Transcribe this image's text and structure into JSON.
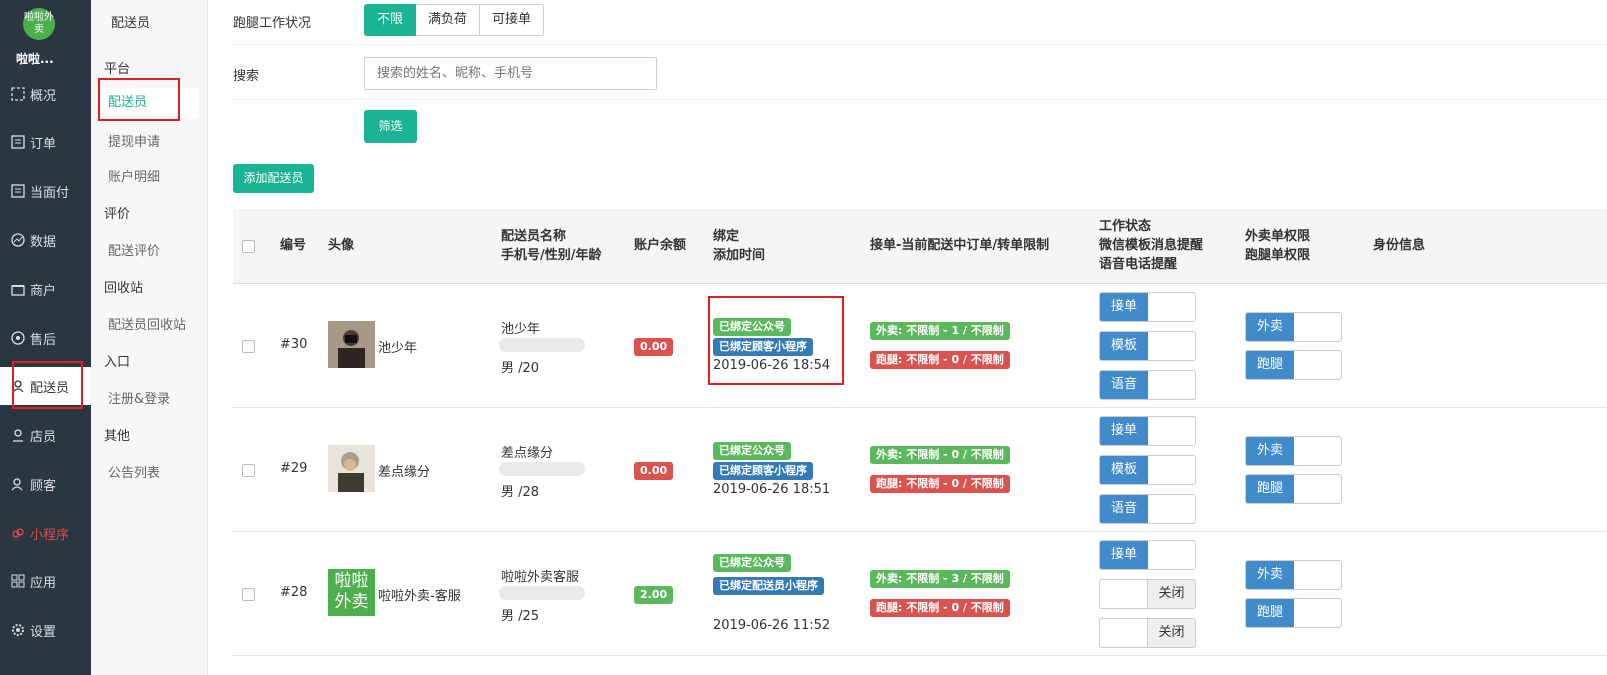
{
  "nav": {
    "logo_text": "啦啦外卖",
    "shop_name": "啦啦...",
    "items": [
      {
        "label": "概况",
        "icon": "dashboard-icon"
      },
      {
        "label": "订单",
        "icon": "order-icon"
      },
      {
        "label": "当面付",
        "icon": "receipt-icon"
      },
      {
        "label": "数据",
        "icon": "chart-icon"
      },
      {
        "label": "商户",
        "icon": "store-icon"
      },
      {
        "label": "售后",
        "icon": "service-icon"
      },
      {
        "label": "配送员",
        "icon": "user-icon"
      },
      {
        "label": "店员",
        "icon": "clerk-icon"
      },
      {
        "label": "顾客",
        "icon": "customer-icon"
      },
      {
        "label": "小程序",
        "icon": "miniprogram-icon"
      },
      {
        "label": "应用",
        "icon": "apps-icon"
      },
      {
        "label": "设置",
        "icon": "gear-icon"
      }
    ]
  },
  "subnav": {
    "title": "配送员",
    "groups": {
      "platform": "平台",
      "review": "评价",
      "recycle": "回收站",
      "entry": "入口",
      "other": "其他"
    },
    "links": {
      "deliverer": "配送员",
      "withdraw": "提现申请",
      "account": "账户明细",
      "delivery_review": "配送评价",
      "deliverer_recycle": "配送员回收站",
      "register": "注册&登录",
      "notice": "公告列表"
    }
  },
  "filters": {
    "status_label": "跑腿工作状况",
    "status_options": [
      "不限",
      "满负荷",
      "可接单"
    ],
    "search_label": "搜索",
    "search_placeholder": "搜索的姓名、昵称、手机号",
    "filter_button": "筛选",
    "add_button": "添加配送员"
  },
  "table": {
    "headers": {
      "id": "编号",
      "avatar": "头像",
      "name_line1": "配送员名称",
      "name_line2": "手机号/性别/年龄",
      "balance": "账户余额",
      "bind_line1": "绑定",
      "bind_line2": "添加时间",
      "limits": "接单-当前配送中订单/转单限制",
      "work_line1": "工作状态",
      "work_line2": "微信模板消息提醒",
      "work_line3": "语音电话提醒",
      "perm_line1": "外卖单权限",
      "perm_line2": "跑腿单权限",
      "identity": "身份信息"
    },
    "rows": [
      {
        "id": "#30",
        "nickname": "池少年",
        "name": "池少年",
        "gender_age": "男 /20",
        "balance": "0.00",
        "balance_color": "#d9534f",
        "bind1": "已绑定公众号",
        "bind2": "已绑定顾客小程序",
        "time": "2019-06-26 18:54",
        "limit1": "外卖:  不限制 - 1 / 不限制",
        "limit2": "跑腿:  不限制 - 0 / 不限制",
        "work": [
          "接单",
          "模板",
          "语音"
        ],
        "perm": [
          "外卖",
          "跑腿"
        ]
      },
      {
        "id": "#29",
        "nickname": "差点缘分",
        "name": "差点缘分",
        "gender_age": "男 /28",
        "balance": "0.00",
        "balance_color": "#d9534f",
        "bind1": "已绑定公众号",
        "bind2": "已绑定顾客小程序",
        "time": "2019-06-26 18:51",
        "limit1": "外卖:  不限制 - 0 / 不限制",
        "limit2": "跑腿:  不限制 - 0 / 不限制",
        "work": [
          "接单",
          "模板",
          "语音"
        ],
        "perm": [
          "外卖",
          "跑腿"
        ]
      },
      {
        "id": "#28",
        "nickname": "啦啦外卖-客服",
        "name": "啦啦外卖客服",
        "gender_age": "男 /25",
        "balance": "2.00",
        "balance_color": "#5cb85c",
        "bind1": "已绑定公众号",
        "bind2": "已绑定配送员小程序",
        "time": "2019-06-26 11:52",
        "limit1": "外卖:  不限制 - 3 / 不限制",
        "limit2": "跑腿:  不限制 - 0 / 不限制",
        "work": [
          "接单",
          "关闭",
          "关闭"
        ],
        "perm": [
          "外卖",
          "跑腿"
        ],
        "avatar_text": "啦啦外卖"
      }
    ]
  }
}
